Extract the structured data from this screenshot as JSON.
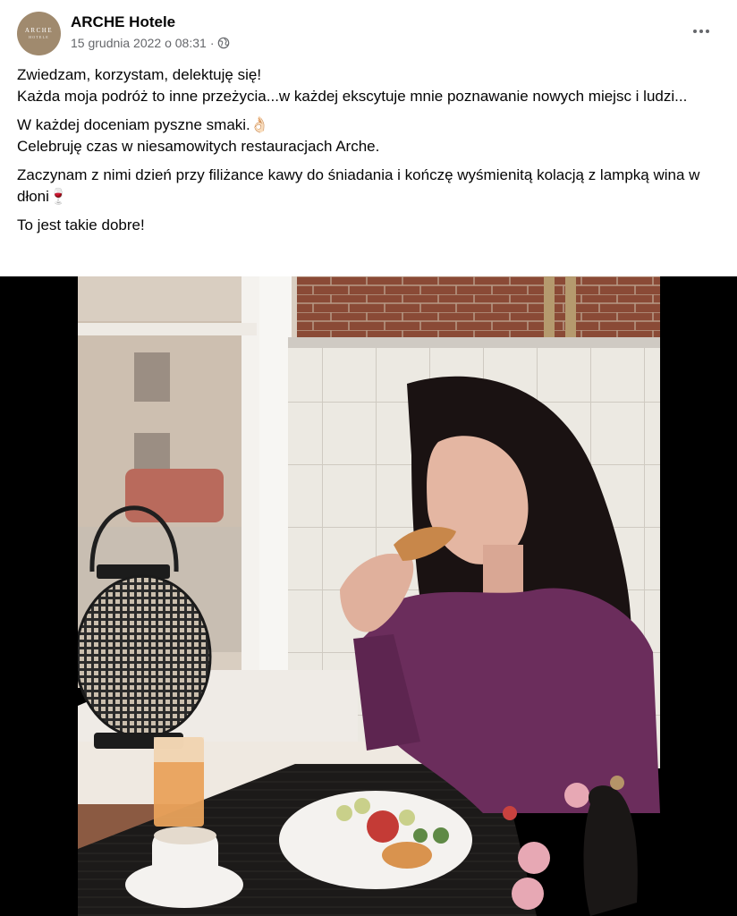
{
  "post": {
    "page_name": "ARCHE Hotele",
    "date": "15 grudnia 2022 o 08:31",
    "separator": "·",
    "privacy_icon": "globe-icon",
    "more_icon": "more-dots-icon",
    "avatar_logo": {
      "line1": "ARCHE",
      "line2": "HOTELE"
    },
    "text": {
      "p1_l1": "Zwiedzam, korzystam, delektuję się!",
      "p1_l2": "Każda moja podróż to inne przeżycia...w każdej ekscytuje mnie poznawanie nowych miejsc i ludzi...",
      "p2_l1": "W każdej doceniam pyszne smaki.👌🏻",
      "p2_l2": "Celebruję czas w niesamowitych restauracjach Arche.",
      "p3": "Zaczynam z nimi dzień przy filiżance kawy do śniadania i kończę wyśmienitą kolacją z lampką wina w dłoni🍷",
      "p4": "To jest takie dobre!"
    }
  },
  "colors": {
    "text": "#050505",
    "secondary_text": "#65676b",
    "avatar": "#a08a6e",
    "photo_background": "#000000",
    "blouse": "#6b2d5c"
  }
}
